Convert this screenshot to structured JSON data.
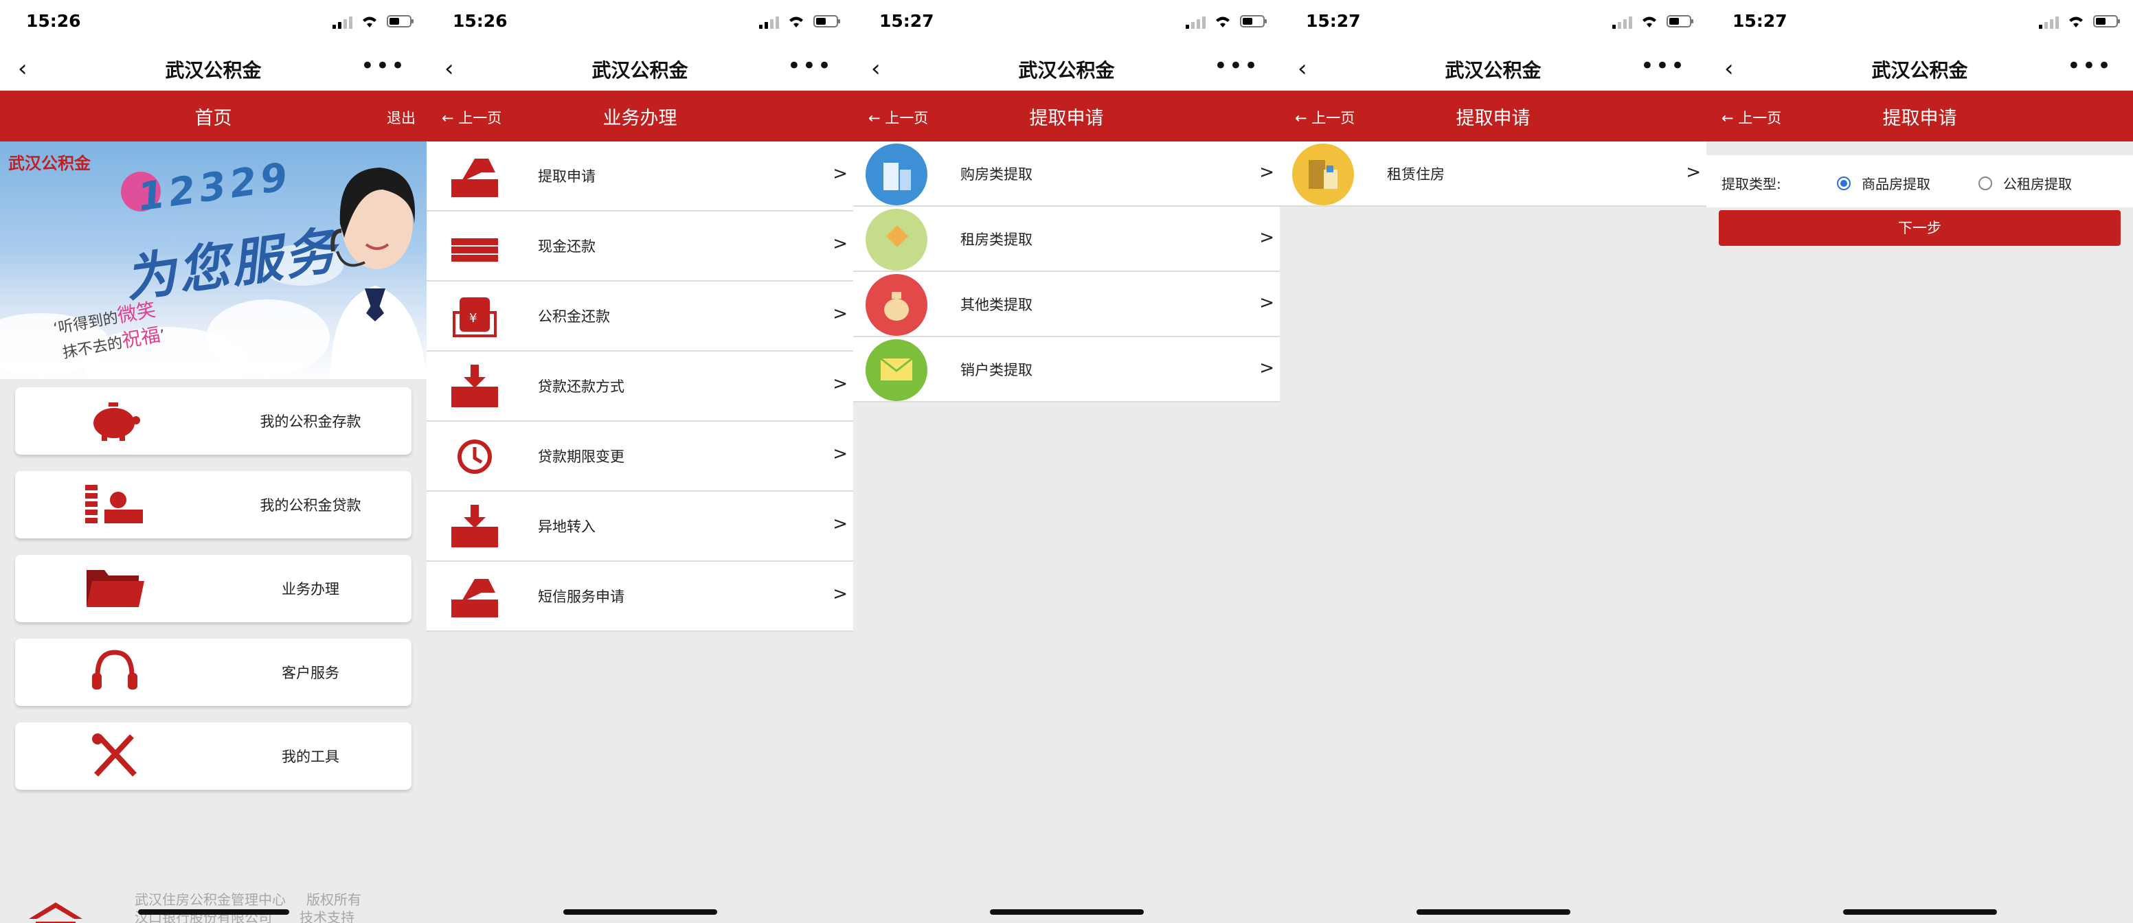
{
  "app": {
    "nav_title": "武汉公积金",
    "back_glyph": "‹",
    "more_glyph": "•••",
    "prev_label": "← 上一页",
    "arrow": ">"
  },
  "screens": [
    {
      "time": "15:26",
      "header": "首页",
      "logout": "退出",
      "banner": {
        "brand": "武汉公积金",
        "hotline": "12329",
        "slogan": "为您服务",
        "quote_a": "听得到的",
        "quote_a_em": "微笑",
        "quote_b": "抹不去的",
        "quote_b_em": "祝福"
      },
      "menu": [
        {
          "label": "我的公积金存款",
          "icon": "piggy-bank-icon"
        },
        {
          "label": "我的公积金贷款",
          "icon": "coins-icon"
        },
        {
          "label": "业务办理",
          "icon": "folder-icon"
        },
        {
          "label": "客户服务",
          "icon": "headset-icon"
        },
        {
          "label": "我的工具",
          "icon": "tools-icon"
        }
      ],
      "footer": {
        "line1": "武汉住房公积金管理中心",
        "line2": "汉口银行股份有限公司",
        "line3": "版权所有",
        "line4": "技术支持"
      }
    },
    {
      "time": "15:26",
      "header": "业务办理",
      "items": [
        {
          "label": "提取申请",
          "icon": "tray-out-icon"
        },
        {
          "label": "现金还款",
          "icon": "cash-icon"
        },
        {
          "label": "公积金还款",
          "icon": "yen-hand-icon"
        },
        {
          "label": "贷款还款方式",
          "icon": "tray-in-icon"
        },
        {
          "label": "贷款期限变更",
          "icon": "clock-icon"
        },
        {
          "label": "异地转入",
          "icon": "tray-in-icon"
        },
        {
          "label": "短信服务申请",
          "icon": "tray-out-icon"
        }
      ]
    },
    {
      "time": "15:27",
      "header": "提取申请",
      "items": [
        {
          "label": "购房类提取",
          "icon": "building-icon",
          "color": "#3d8fd6"
        },
        {
          "label": "租房类提取",
          "icon": "tag-icon",
          "color": "#c5dd8a"
        },
        {
          "label": "其他类提取",
          "icon": "money-bag-icon",
          "color": "#e24a4a"
        },
        {
          "label": "销户类提取",
          "icon": "envelope-icon",
          "color": "#7cbf3c"
        }
      ]
    },
    {
      "time": "15:27",
      "header": "提取申请",
      "items": [
        {
          "label": "租赁住房",
          "icon": "apartment-icon",
          "color": "#f2c13c"
        }
      ]
    },
    {
      "time": "15:27",
      "header": "提取申请",
      "form": {
        "type_label": "提取类型:",
        "option1": "商品房提取",
        "option2": "公租房提取",
        "selected": "商品房提取",
        "next": "下一步"
      }
    }
  ]
}
